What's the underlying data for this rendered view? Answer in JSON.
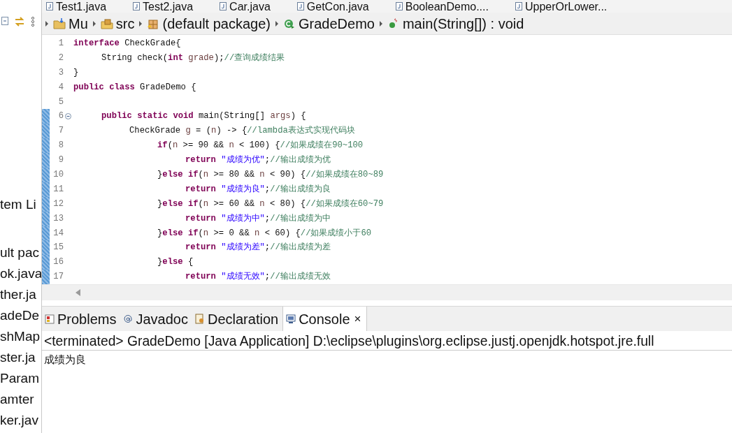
{
  "sidebar": {
    "items": [
      "tem Li",
      "ult pac",
      "ok.java",
      "ther.ja",
      "adeDe",
      "shMap",
      "ster.ja",
      "Param",
      "amter",
      "ker.jav"
    ]
  },
  "editor_tabs": [
    {
      "label": "Test1.java"
    },
    {
      "label": "Test2.java"
    },
    {
      "label": "Car.java"
    },
    {
      "label": "GetCon.java"
    },
    {
      "label": "BooleanDemo...."
    },
    {
      "label": "UpperOrLower..."
    }
  ],
  "breadcrumb": [
    {
      "kind": "project",
      "label": "Mu"
    },
    {
      "kind": "folder",
      "label": "src"
    },
    {
      "kind": "package",
      "label": "(default package)"
    },
    {
      "kind": "class",
      "label": "GradeDemo"
    },
    {
      "kind": "method",
      "label": "main(String[]) : void"
    }
  ],
  "code": [
    {
      "number": "1",
      "changed": false,
      "fold": false,
      "tokens": [
        {
          "kind": "keyword",
          "text": "interface"
        },
        {
          "kind": "plain",
          "text": " CheckGrade{"
        }
      ]
    },
    {
      "number": "2",
      "changed": false,
      "fold": false,
      "tokens": [
        {
          "kind": "plain",
          "text": "\tString check("
        },
        {
          "kind": "keyword",
          "text": "int "
        },
        {
          "kind": "variable",
          "text": "grade"
        },
        {
          "kind": "plain",
          "text": ");"
        },
        {
          "kind": "comment",
          "text": "//查询成绩结果"
        }
      ]
    },
    {
      "number": "3",
      "changed": false,
      "fold": false,
      "tokens": [
        {
          "kind": "plain",
          "text": "}"
        }
      ]
    },
    {
      "number": "4",
      "changed": false,
      "fold": false,
      "tokens": [
        {
          "kind": "keyword",
          "text": "public class"
        },
        {
          "kind": "plain",
          "text": " GradeDemo {"
        }
      ]
    },
    {
      "number": "5",
      "changed": false,
      "fold": false
    },
    {
      "number": "6",
      "changed": true,
      "fold": true,
      "tokens": [
        {
          "kind": "keyword",
          "text": "\tpublic static void"
        },
        {
          "kind": "plain",
          "text": " main(String[] "
        },
        {
          "kind": "variable",
          "text": "args"
        },
        {
          "kind": "plain",
          "text": ") {"
        }
      ]
    },
    {
      "number": "7",
      "changed": true,
      "fold": false,
      "tokens": [
        {
          "kind": "plain",
          "text": "\t\tCheckGrade "
        },
        {
          "kind": "variable",
          "text": "g"
        },
        {
          "kind": "plain",
          "text": " = ("
        },
        {
          "kind": "variable",
          "text": "n"
        },
        {
          "kind": "plain",
          "text": ") -> {"
        },
        {
          "kind": "comment",
          "text": "//lambda表达式实现代码块"
        }
      ]
    },
    {
      "number": "8",
      "changed": true,
      "fold": false,
      "tokens": [
        {
          "kind": "keyword",
          "text": "\t\t\tif"
        },
        {
          "kind": "plain",
          "text": "("
        },
        {
          "kind": "variable",
          "text": "n"
        },
        {
          "kind": "plain",
          "text": " >= 90 && "
        },
        {
          "kind": "variable",
          "text": "n"
        },
        {
          "kind": "plain",
          "text": " < 100) {"
        },
        {
          "kind": "comment",
          "text": "//如果成绩在90~100"
        }
      ]
    },
    {
      "number": "9",
      "changed": true,
      "fold": false,
      "tokens": [
        {
          "kind": "keyword",
          "text": "\t\t\t\treturn "
        },
        {
          "kind": "string",
          "text": "\"成绩为优\""
        },
        {
          "kind": "plain",
          "text": ";"
        },
        {
          "kind": "comment",
          "text": "//输出成绩为优"
        }
      ]
    },
    {
      "number": "10",
      "changed": true,
      "fold": false,
      "tokens": [
        {
          "kind": "plain",
          "text": "\t\t\t}"
        },
        {
          "kind": "keyword",
          "text": "else if"
        },
        {
          "kind": "plain",
          "text": "("
        },
        {
          "kind": "variable",
          "text": "n"
        },
        {
          "kind": "plain",
          "text": " >= 80 && "
        },
        {
          "kind": "variable",
          "text": "n"
        },
        {
          "kind": "plain",
          "text": " < 90) {"
        },
        {
          "kind": "comment",
          "text": "//如果成绩在80~89"
        }
      ]
    },
    {
      "number": "11",
      "changed": true,
      "fold": false,
      "tokens": [
        {
          "kind": "keyword",
          "text": "\t\t\t\treturn "
        },
        {
          "kind": "string",
          "text": "\"成绩为良\""
        },
        {
          "kind": "plain",
          "text": ";"
        },
        {
          "kind": "comment",
          "text": "//输出成绩为良"
        }
      ]
    },
    {
      "number": "12",
      "changed": true,
      "fold": false,
      "tokens": [
        {
          "kind": "plain",
          "text": "\t\t\t}"
        },
        {
          "kind": "keyword",
          "text": "else if"
        },
        {
          "kind": "plain",
          "text": "("
        },
        {
          "kind": "variable",
          "text": "n"
        },
        {
          "kind": "plain",
          "text": " >= 60 && "
        },
        {
          "kind": "variable",
          "text": "n"
        },
        {
          "kind": "plain",
          "text": " < 80) {"
        },
        {
          "kind": "comment",
          "text": "//如果成绩在60~79"
        }
      ]
    },
    {
      "number": "13",
      "changed": true,
      "fold": false,
      "tokens": [
        {
          "kind": "keyword",
          "text": "\t\t\t\treturn "
        },
        {
          "kind": "string",
          "text": "\"成绩为中\""
        },
        {
          "kind": "plain",
          "text": ";"
        },
        {
          "kind": "comment",
          "text": "//输出成绩为中"
        }
      ]
    },
    {
      "number": "14",
      "changed": true,
      "fold": false,
      "tokens": [
        {
          "kind": "plain",
          "text": "\t\t\t}"
        },
        {
          "kind": "keyword",
          "text": "else if"
        },
        {
          "kind": "plain",
          "text": "("
        },
        {
          "kind": "variable",
          "text": "n"
        },
        {
          "kind": "plain",
          "text": " >= 0 && "
        },
        {
          "kind": "variable",
          "text": "n"
        },
        {
          "kind": "plain",
          "text": " < 60) {"
        },
        {
          "kind": "comment",
          "text": "//如果成绩小于60"
        }
      ]
    },
    {
      "number": "15",
      "changed": true,
      "fold": false,
      "tokens": [
        {
          "kind": "keyword",
          "text": "\t\t\t\treturn "
        },
        {
          "kind": "string",
          "text": "\"成绩为差\""
        },
        {
          "kind": "plain",
          "text": ";"
        },
        {
          "kind": "comment",
          "text": "//输出成绩为差"
        }
      ]
    },
    {
      "number": "16",
      "changed": true,
      "fold": false,
      "tokens": [
        {
          "kind": "plain",
          "text": "\t\t\t}"
        },
        {
          "kind": "keyword",
          "text": "else"
        },
        {
          "kind": "plain",
          "text": " {"
        }
      ]
    },
    {
      "number": "17",
      "changed": true,
      "fold": false,
      "tokens": [
        {
          "kind": "keyword",
          "text": "\t\t\t\treturn "
        },
        {
          "kind": "string",
          "text": "\"成绩无效\""
        },
        {
          "kind": "plain",
          "text": ";"
        },
        {
          "kind": "comment",
          "text": "//输出成绩无效"
        }
      ]
    }
  ],
  "view_tabs": [
    {
      "kind": "problems",
      "label": "Problems",
      "selected": false
    },
    {
      "kind": "javadoc",
      "label": "Javadoc",
      "selected": false
    },
    {
      "kind": "declaration",
      "label": "Declaration",
      "selected": false
    },
    {
      "kind": "console",
      "label": "Console",
      "selected": true,
      "close": "×"
    }
  ],
  "console": {
    "header": "<terminated> GradeDemo [Java Application] D:\\eclipse\\plugins\\org.eclipse.justj.openjdk.hotspot.jre.full",
    "output": [
      "成绩为良"
    ]
  }
}
